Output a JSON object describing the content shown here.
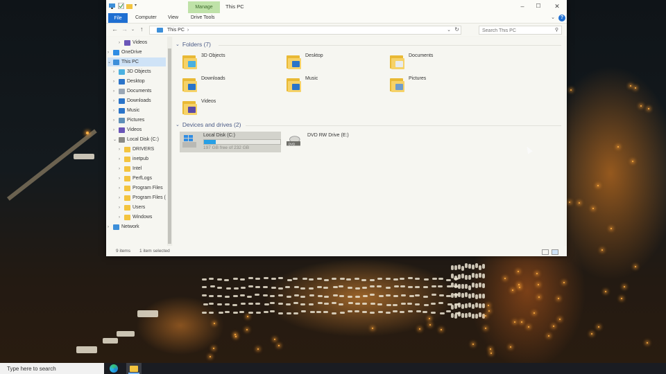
{
  "window": {
    "title": "This PC",
    "context_tab": "Manage",
    "ribbon_tabs": [
      "File",
      "Computer",
      "View",
      "Drive Tools"
    ],
    "help_label": "?"
  },
  "address": {
    "path": "This PC",
    "separator": "›",
    "search_placeholder": "Search This PC"
  },
  "nav_pane": [
    {
      "label": "Videos",
      "icon": "videos-icon",
      "indent": 2
    },
    {
      "label": "OneDrive",
      "icon": "cloud-icon",
      "indent": 0
    },
    {
      "label": "This PC",
      "icon": "computer-icon",
      "indent": 0,
      "selected": true
    },
    {
      "label": "3D Objects",
      "icon": "3d-objects-icon",
      "indent": 1
    },
    {
      "label": "Desktop",
      "icon": "desktop-icon",
      "indent": 1
    },
    {
      "label": "Documents",
      "icon": "documents-icon",
      "indent": 1
    },
    {
      "label": "Downloads",
      "icon": "downloads-icon",
      "indent": 1
    },
    {
      "label": "Music",
      "icon": "music-icon",
      "indent": 1
    },
    {
      "label": "Pictures",
      "icon": "pictures-icon",
      "indent": 1
    },
    {
      "label": "Videos",
      "icon": "videos-icon",
      "indent": 1
    },
    {
      "label": "Local Disk (C:)",
      "icon": "disk-icon",
      "indent": 1
    },
    {
      "label": "DRIVERS",
      "icon": "folder-icon",
      "indent": 2
    },
    {
      "label": "inetpub",
      "icon": "folder-icon",
      "indent": 2
    },
    {
      "label": "Intel",
      "icon": "folder-icon",
      "indent": 2
    },
    {
      "label": "PerfLogs",
      "icon": "folder-icon",
      "indent": 2
    },
    {
      "label": "Program Files",
      "icon": "folder-icon",
      "indent": 2
    },
    {
      "label": "Program Files (",
      "icon": "folder-icon",
      "indent": 2
    },
    {
      "label": "Users",
      "icon": "folder-icon",
      "indent": 2
    },
    {
      "label": "Windows",
      "icon": "folder-icon",
      "indent": 2
    },
    {
      "label": "Network",
      "icon": "network-icon",
      "indent": 0
    }
  ],
  "folders_group": {
    "header": "Folders (7)",
    "items": [
      {
        "label": "3D Objects",
        "icon": "3d-objects-icon"
      },
      {
        "label": "Desktop",
        "icon": "desktop-icon"
      },
      {
        "label": "Documents",
        "icon": "documents-icon"
      },
      {
        "label": "Downloads",
        "icon": "downloads-icon"
      },
      {
        "label": "Music",
        "icon": "music-icon"
      },
      {
        "label": "Pictures",
        "icon": "pictures-icon"
      },
      {
        "label": "Videos",
        "icon": "videos-icon"
      }
    ]
  },
  "drives_group": {
    "header": "Devices and drives (2)",
    "items": [
      {
        "label": "Local Disk (C:)",
        "free_text": "197 GB free of 232 GB",
        "used_fraction": 0.15,
        "icon": "windows-disk-icon",
        "selected": true
      },
      {
        "label": "DVD RW Drive (E:)",
        "icon": "dvd-drive-icon",
        "dvd_label": "DVD"
      }
    ]
  },
  "status": {
    "items_count": "9 items",
    "selection": "1 item selected"
  },
  "taskbar": {
    "search_placeholder": "Type here to search"
  },
  "colors": {
    "accent": "#1f6fd1",
    "manage_tab": "#bfe2a8",
    "folder": "#f6d268",
    "drive_bar": "#27a0e6"
  }
}
